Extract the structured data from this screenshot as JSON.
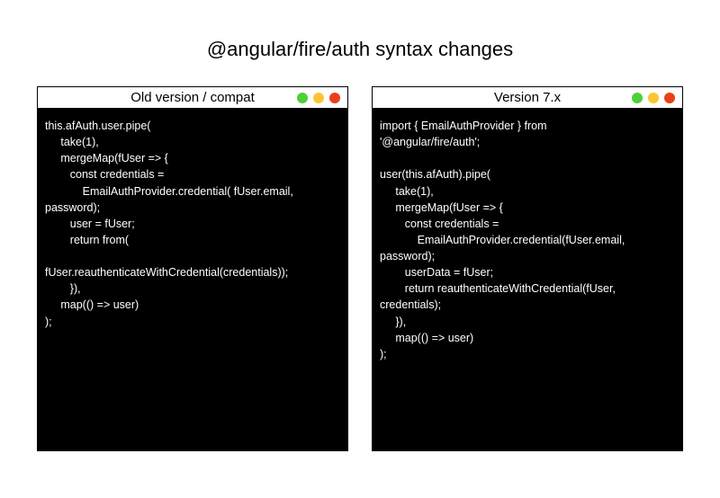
{
  "title": "@angular/fire/auth syntax changes",
  "panels": {
    "left": {
      "title": "Old version / compat",
      "code": "this.afAuth.user.pipe(\n     take(1),\n     mergeMap(fUser => {\n        const credentials =\n            EmailAuthProvider.credential( fUser.email,\npassword);\n        user = fUser;\n        return from(\n\nfUser.reauthenticateWithCredential(credentials));\n        }),\n     map(() => user)\n);"
    },
    "right": {
      "title": "Version 7.x",
      "code": "import { EmailAuthProvider } from\n'@angular/fire/auth';\n\nuser(this.afAuth).pipe(\n     take(1),\n     mergeMap(fUser => {\n        const credentials =\n            EmailAuthProvider.credential(fUser.email,\npassword);\n        userData = fUser;\n        return reauthenticateWithCredential(fUser,\ncredentials);\n     }),\n     map(() => user)\n);"
    }
  }
}
